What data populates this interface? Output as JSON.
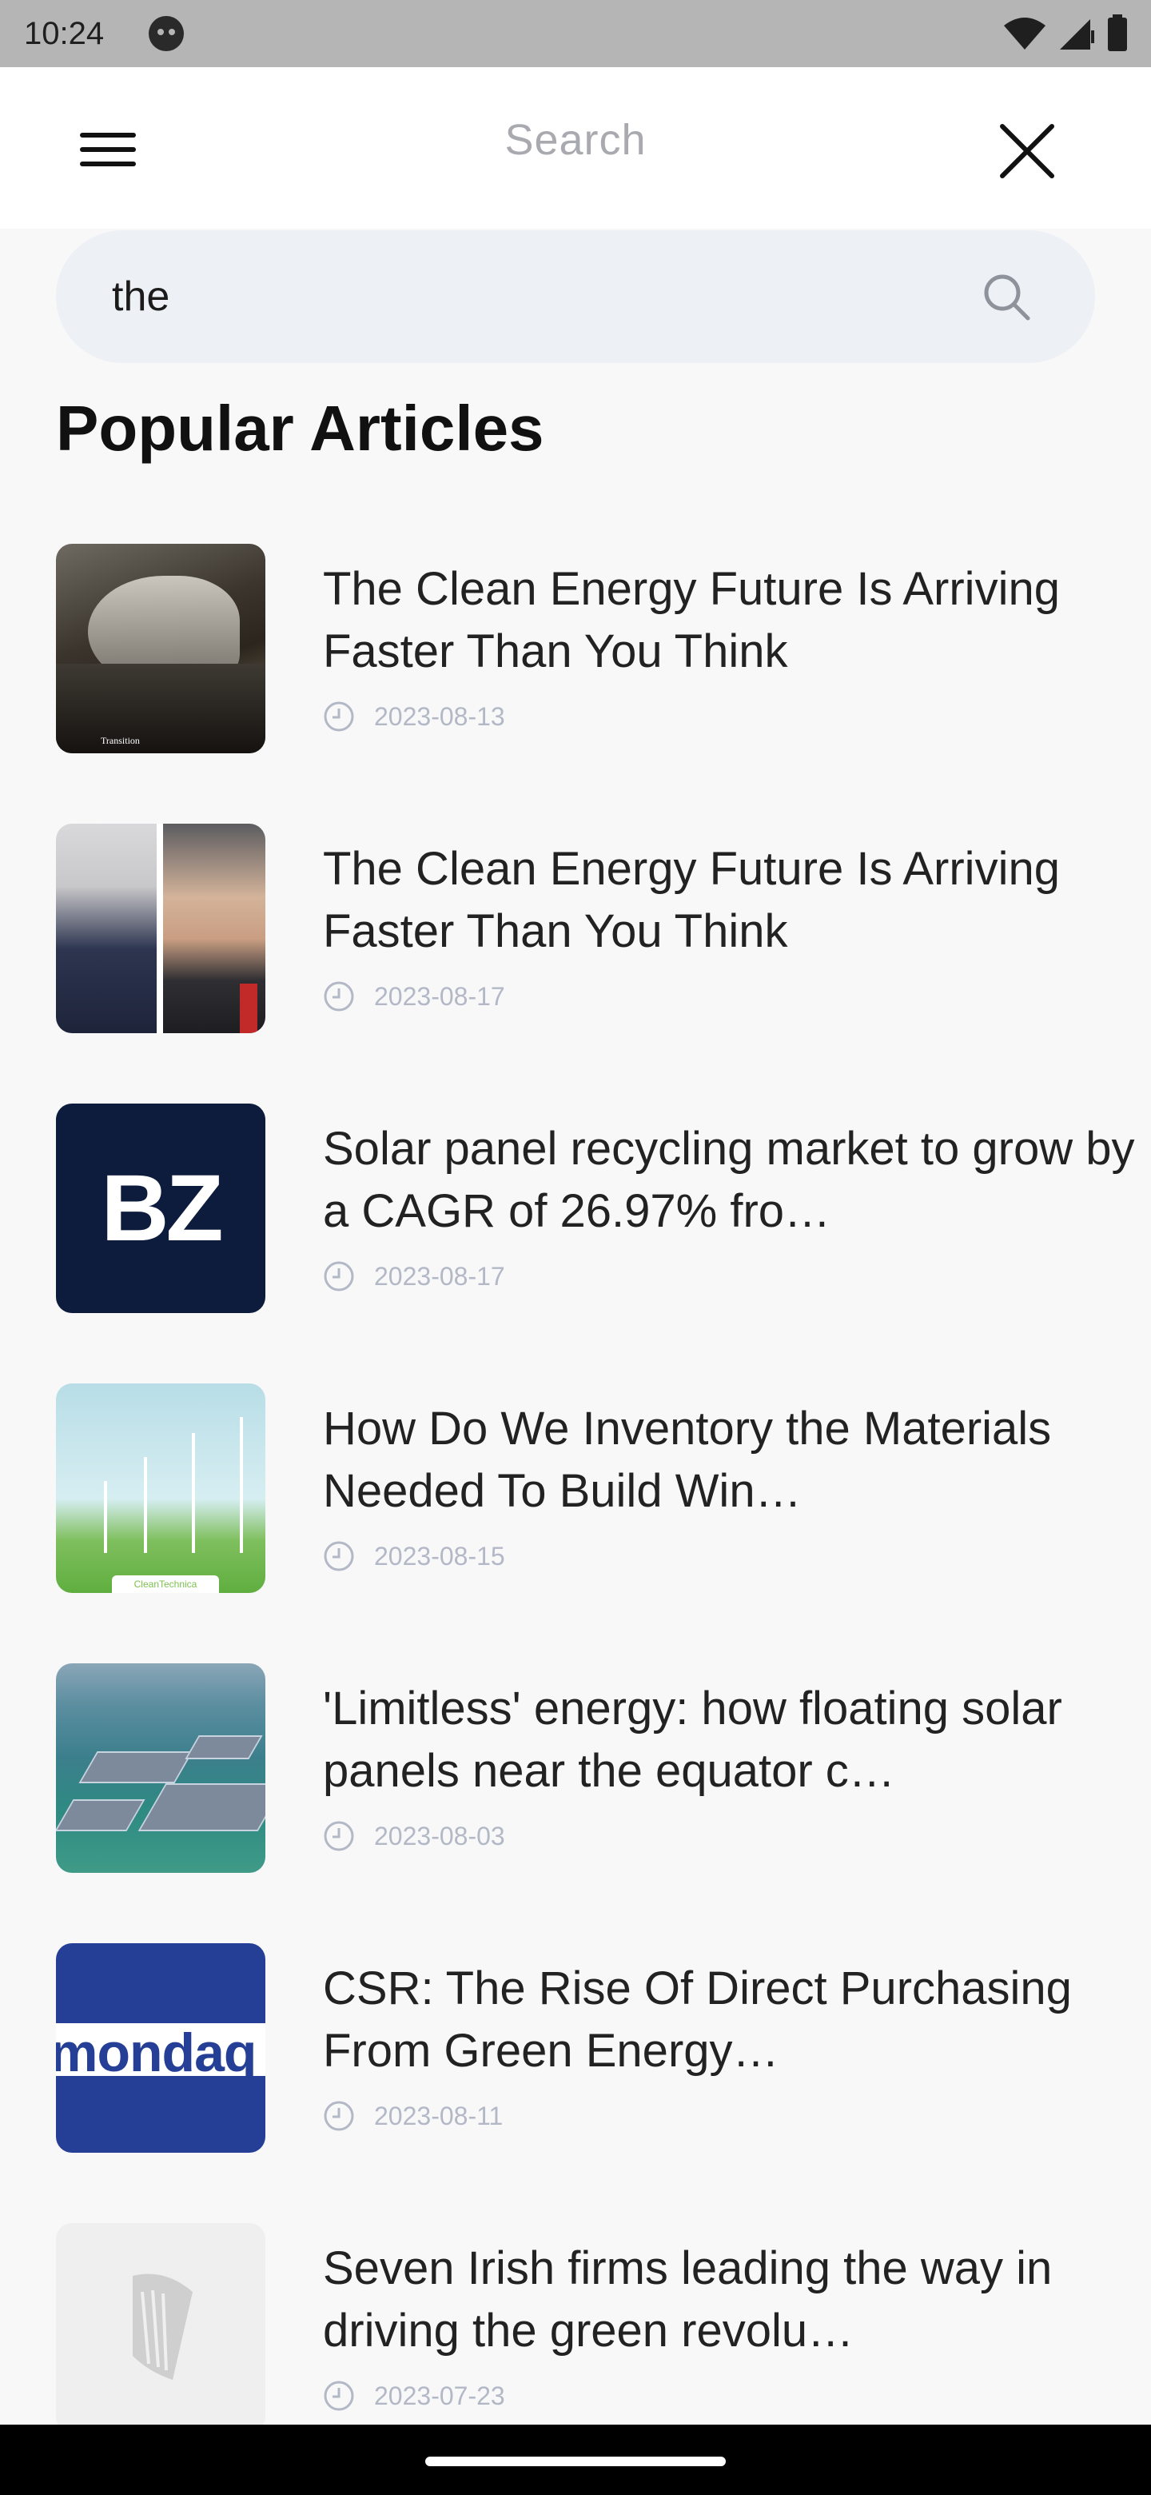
{
  "status_bar": {
    "time": "10:24"
  },
  "app_bar": {
    "title": "Search"
  },
  "search": {
    "value": "the"
  },
  "section": {
    "title": "Popular Articles"
  },
  "articles": [
    {
      "title": "The Clean Energy Future Is Arriving Faster Than You Think",
      "date": "2023-08-13",
      "thumb_caption": "Transition"
    },
    {
      "title": "The Clean Energy Future Is Arriving Faster Than You Think",
      "date": "2023-08-17"
    },
    {
      "title": "Solar panel recycling market to grow by a CAGR of 26.97% fro…",
      "date": "2023-08-17",
      "thumb_logo": "BZ"
    },
    {
      "title": "How Do We Inventory the Materials Needed To Build Win…",
      "date": "2023-08-15",
      "thumb_logo": "CleanTechnica"
    },
    {
      "title": "'Limitless' energy: how floating solar panels near the equator c…",
      "date": "2023-08-03"
    },
    {
      "title": "CSR: The Rise Of Direct Purchasing From Green Energy…",
      "date": "2023-08-11",
      "thumb_logo": "mondaq"
    },
    {
      "title": "Seven Irish firms leading the way in driving the green revolu…",
      "date": "2023-07-23"
    }
  ],
  "colors": {
    "accent_navy": "#0d1b3d",
    "date_gray": "#b3b8c6",
    "search_bg": "#edf0f5"
  },
  "icons": [
    "menu-icon",
    "close-icon",
    "search-icon",
    "clock-icon",
    "wifi-icon",
    "signal-icon",
    "battery-icon"
  ]
}
